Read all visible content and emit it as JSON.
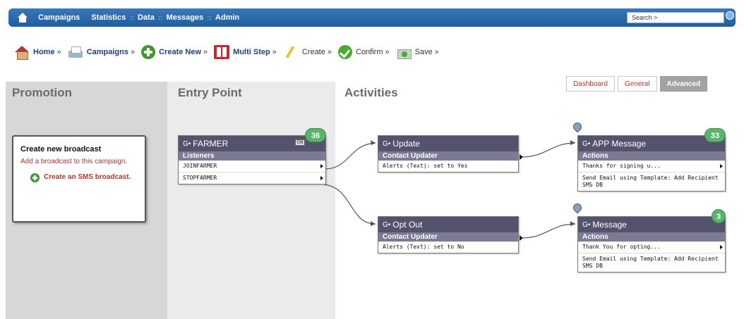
{
  "topnav": {
    "items": [
      "Campaigns",
      "Statistics",
      "Data",
      "Messages",
      "Admin"
    ],
    "separator": "::",
    "search_value": "Search >"
  },
  "breadcrumb": [
    {
      "label": "Home",
      "icon": "house-icon"
    },
    {
      "label": "Campaigns",
      "icon": "tray-icon"
    },
    {
      "label": "Create New",
      "icon": "plus-circle-icon"
    },
    {
      "label": "Multi Step",
      "icon": "grid-icon"
    },
    {
      "label": "Create",
      "icon": "pencil-icon"
    },
    {
      "label": "Confirm",
      "icon": "check-circle-icon"
    },
    {
      "label": "Save",
      "icon": "save-icon"
    }
  ],
  "breadcrumb_arrow": "»",
  "tabs": [
    "Dashboard",
    "General",
    "Advanced"
  ],
  "active_tab": "Advanced",
  "columns": {
    "promotion": "Promotion",
    "entry": "Entry Point",
    "activities": "Activities"
  },
  "promo_box": {
    "title": "Create new broadcast",
    "description": "Add a broadcast to this campaign.",
    "action": "Create an SMS broadcast."
  },
  "nodes": {
    "farmer": {
      "title": "FARMER",
      "badge": "36",
      "toggle": "ON",
      "section": "Listeners",
      "rows": [
        "JOINFARMER",
        "STOPFARMER"
      ]
    },
    "update": {
      "title": "Update",
      "section": "Contact Updater",
      "rows": [
        "Alerts (Text): set to Yes"
      ]
    },
    "optout": {
      "title": "Opt Out",
      "section": "Contact Updater",
      "rows": [
        "Alerts (Text): set to No"
      ]
    },
    "app_message": {
      "title": "APP Message",
      "badge": "33",
      "section": "Actions",
      "rows": [
        "Thanks for signing u...",
        "Send Email using Template: Add Recipient SMS DB"
      ]
    },
    "message": {
      "title": "Message",
      "badge": "3",
      "section": "Actions",
      "rows": [
        "Thank You for opting...",
        "Send Email using Template: Add Recipient SMS DB"
      ]
    }
  },
  "header_glyph": "G•"
}
